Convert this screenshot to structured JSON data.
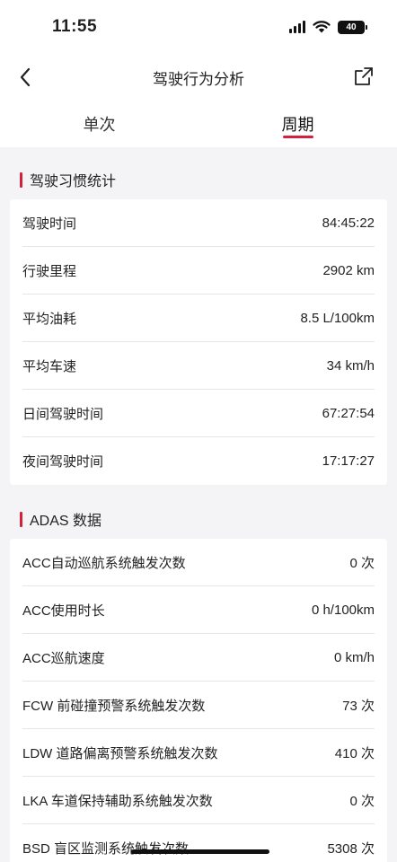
{
  "status_bar": {
    "time": "11:55",
    "battery": "40"
  },
  "nav": {
    "title": "驾驶行为分析"
  },
  "tabs": [
    {
      "label": "单次",
      "active": false
    },
    {
      "label": "周期",
      "active": true
    }
  ],
  "habits": {
    "title": "驾驶习惯统计",
    "rows": [
      {
        "label": "驾驶时间",
        "value": "84:45:22"
      },
      {
        "label": "行驶里程",
        "value": "2902 km"
      },
      {
        "label": "平均油耗",
        "value": "8.5 L/100km"
      },
      {
        "label": "平均车速",
        "value": "34 km/h"
      },
      {
        "label": "日间驾驶时间",
        "value": "67:27:54"
      },
      {
        "label": "夜间驾驶时间",
        "value": "17:17:27"
      }
    ]
  },
  "adas": {
    "title": "ADAS 数据",
    "rows": [
      {
        "label": "ACC自动巡航系统触发次数",
        "value": "0 次"
      },
      {
        "label": "ACC使用时长",
        "value": "0 h/100km"
      },
      {
        "label": "ACC巡航速度",
        "value": "0 km/h"
      },
      {
        "label": "FCW 前碰撞预警系统触发次数",
        "value": "73 次"
      },
      {
        "label": "LDW 道路偏离预警系统触发次数",
        "value": "410 次"
      },
      {
        "label": "LKA 车道保持辅助系统触发次数",
        "value": "0 次"
      },
      {
        "label": "BSD 盲区监测系统触发次数",
        "value": "5308 次"
      }
    ]
  },
  "colors": {
    "accent": "#d4213b",
    "background": "#f4f4f6",
    "card": "#ffffff"
  },
  "icons": {
    "back": "chevron-left-icon",
    "share": "share-external-icon",
    "wifi": "wifi-icon",
    "signal": "cellular-signal-icon",
    "battery": "battery-icon"
  }
}
